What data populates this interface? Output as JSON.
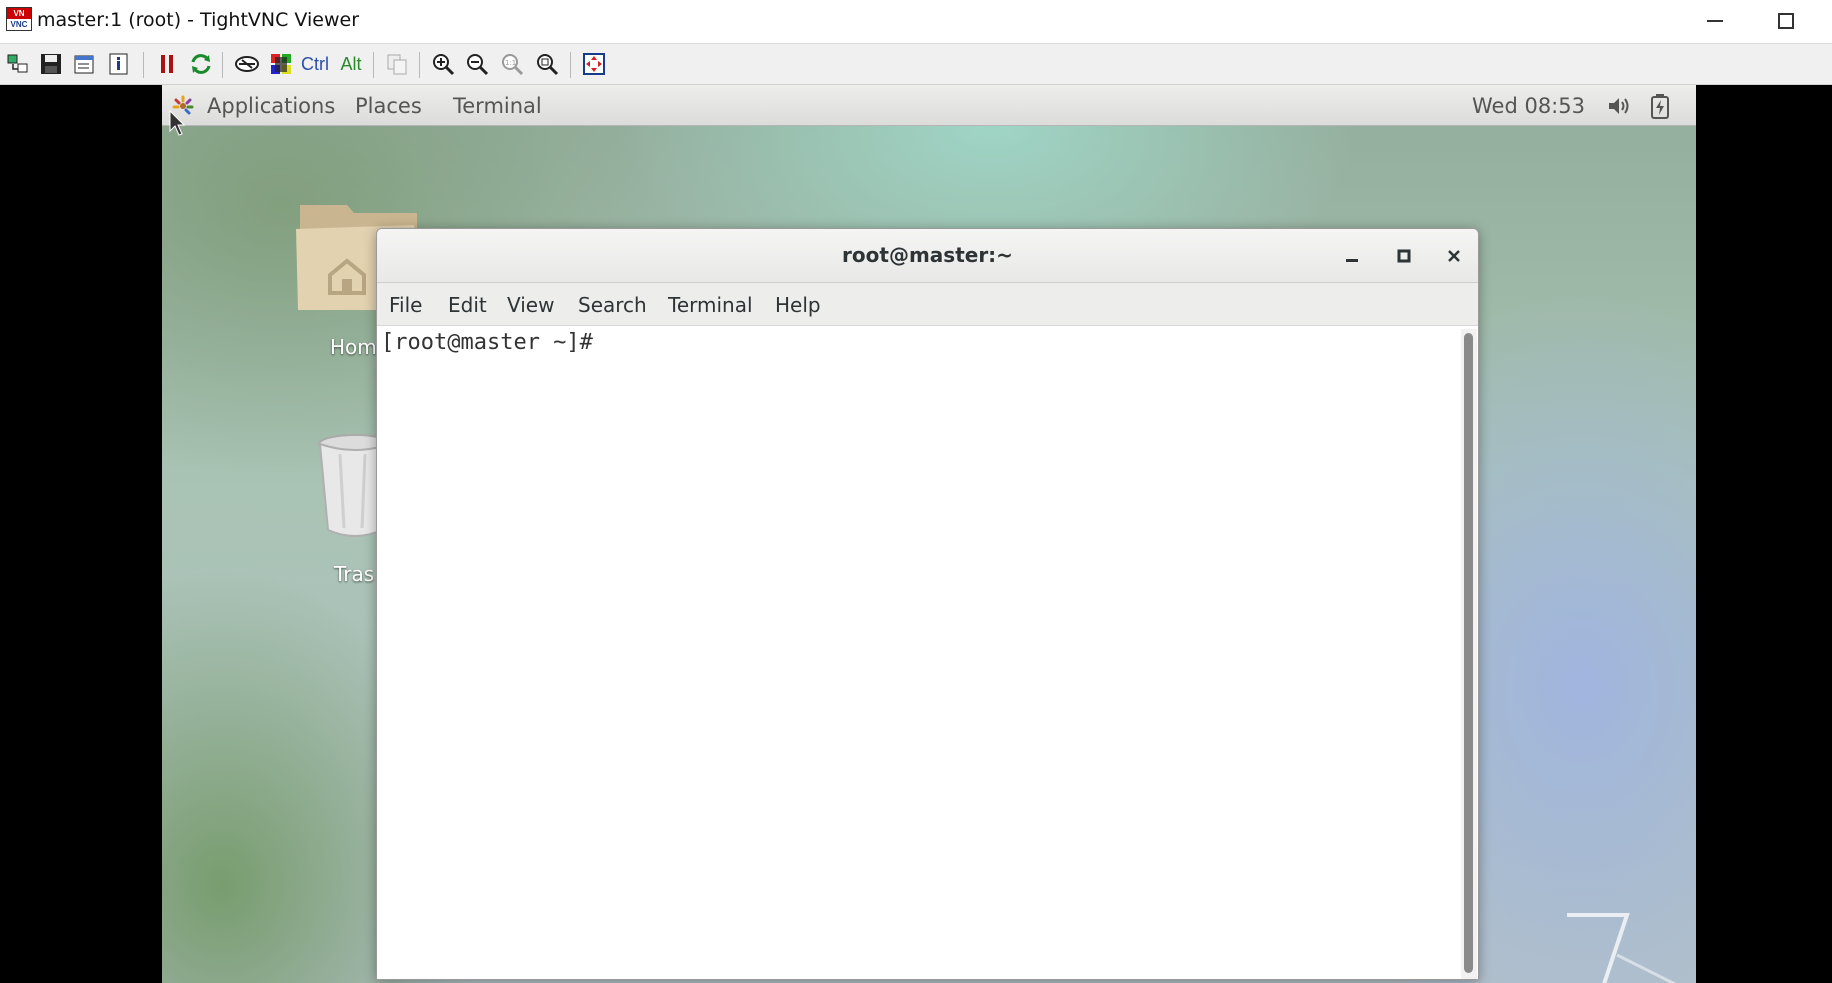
{
  "window": {
    "title": "master:1 (root) - TightVNC Viewer"
  },
  "toolbar": {
    "ctrl_label": "Ctrl",
    "alt_label": "Alt",
    "icons": [
      "new-connection-icon",
      "save-icon",
      "options-icon",
      "info-icon",
      "pause-icon",
      "refresh-icon",
      "ctrl-alt-del-icon",
      "ctrl-esc-icon",
      "ctrl-key-icon",
      "alt-key-icon",
      "copy-icon",
      "zoom-in-icon",
      "zoom-out-icon",
      "zoom-100-icon",
      "zoom-fit-icon",
      "fullscreen-icon"
    ]
  },
  "gnome_panel": {
    "applications": "Applications",
    "places": "Places",
    "terminal": "Terminal",
    "clock": "Wed 08:53"
  },
  "desktop": {
    "home_label": "Hom",
    "trash_label": "Tras"
  },
  "terminal": {
    "title": "root@master:~",
    "menu": [
      "File",
      "Edit",
      "View",
      "Search",
      "Terminal",
      "Help"
    ],
    "prompt": "[root@master ~]#"
  },
  "colors": {
    "panel_bg": "#e4e4e3",
    "terminal_bg": "#ffffff",
    "remote_frame_bg": "#000000"
  }
}
